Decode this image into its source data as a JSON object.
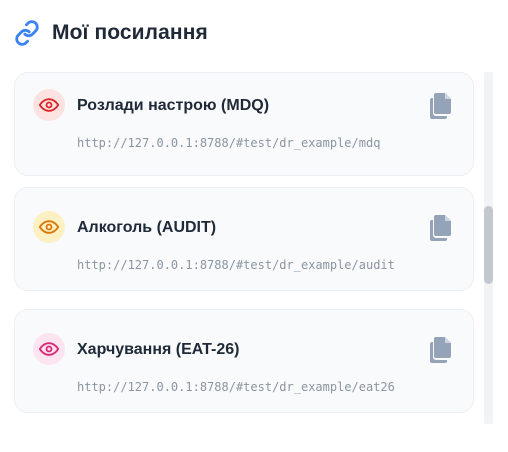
{
  "header": {
    "title": "Мої посилання",
    "icon": "link-icon",
    "icon_color": "#3b82f6"
  },
  "links": [
    {
      "name": "Розлади настрою (MDQ)",
      "url": "http://127.0.0.1:8788/#test/dr_example/mdq",
      "eye_icon": "eye-icon",
      "eye_color": "#dc2626",
      "eye_bg": "#fde2e2"
    },
    {
      "name": "Алкоголь (AUDIT)",
      "url": "http://127.0.0.1:8788/#test/dr_example/audit",
      "eye_icon": "eye-icon",
      "eye_color": "#d97706",
      "eye_bg": "#fdf0c3"
    },
    {
      "name": "Харчування (EAT-26)",
      "url": "http://127.0.0.1:8788/#test/dr_example/eat26",
      "eye_icon": "eye-icon",
      "eye_color": "#db2777",
      "eye_bg": "#fce4f1"
    }
  ],
  "copy_icon": "copy-icon",
  "copy_color": "#94a3b8"
}
